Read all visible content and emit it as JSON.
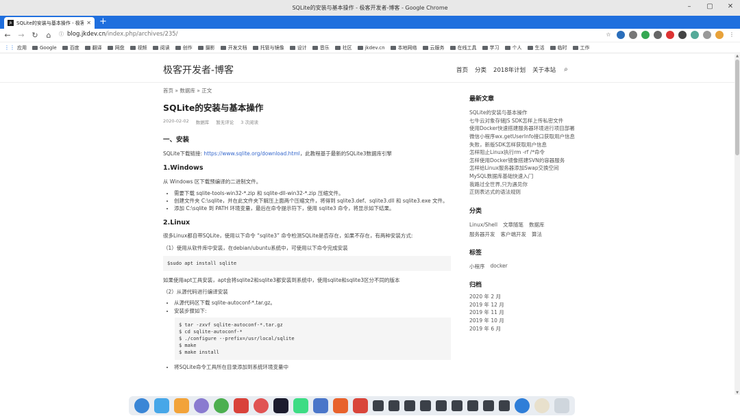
{
  "window": {
    "title": "SQLite的安装与基本操作 - 极客开发者-博客 - Google Chrome"
  },
  "tab": {
    "title": "SQLite的安装与基本操作 - 极客",
    "favicon": "jk"
  },
  "address": {
    "host": "blog.jkdev.cn",
    "path": "/index.php/archives/235/"
  },
  "bookmarks": [
    "应用",
    "Google",
    "百度",
    "翻译",
    "网盘",
    "视频",
    "阅读",
    "创作",
    "摄影",
    "开发文档",
    "托管与镜像",
    "设计",
    "音乐",
    "社区",
    "jkdev.cn",
    "本地网络",
    "云服务",
    "在线工具",
    "学习",
    "个人",
    "生活",
    "临时",
    "工作"
  ],
  "site": {
    "title": "极客开发者-博客",
    "nav": [
      "首页",
      "分类",
      "2018年计划",
      "关于本站"
    ]
  },
  "post": {
    "breadcrumb": "首页 » 数据库 » 正文",
    "title": "SQLite的安装与基本操作",
    "date": "2020-02-02",
    "category": "数据库",
    "comments": "暂无评论",
    "reads": "3 次阅读",
    "h_install": "一、安装",
    "dl_prefix": "SQLite下载链接: ",
    "dl_link": "https://www.sqlite.org/download.html",
    "dl_suffix": "，此教程基于最新的SQLite3数据库引擎",
    "h_windows": "1.Windows",
    "win_intro": "从 Windows 区下载预编译的二进制文件。",
    "win_steps": [
      "需要下载 sqlite-tools-win32-*.zip 和 sqlite-dll-win32-*.zip 压缩文件。",
      "创建文件夹 C:\\sqlite，并在此文件夹下解压上面两个压缩文件，将得到 sqlite3.def、sqlite3.dll 和 sqlite3.exe 文件。",
      "添加 C:\\sqlite 到 PATH 环境变量，最后在命令提示符下，使用 sqlite3 命令，将显示如下结果。"
    ],
    "h_linux": "2.Linux",
    "linux_intro": "很多Linux都自带SQLite，使用以下命令 “sqlite3” 命令检测SQLite是否存在，如果不存在，有两种安装方式:",
    "linux_opt1": "（1）使用从软件库中安装，在debian/ubuntu系统中，可使用以下命令完成安装",
    "code1": "$sudo apt install sqlite",
    "apt_note": "如果使用apt工具安装，apt会将sqlite2和sqlite3都安装到系统中，使用sqlite和sqlite3区分不同的版本",
    "linux_opt2": "（2）从源代码进行编译安装",
    "src_steps": [
      "从源代码区下载 sqlite-autoconf-*.tar.gz。",
      "安装步骤如下:"
    ],
    "code2": [
      "$ tar -zxvf sqlite-autoconf-*.tar.gz",
      "$ cd sqlite-autoconf-*",
      "$ ./configure --prefix=/usr/local/sqlite",
      "$ make",
      "$ make install"
    ],
    "last_step": "将SQLite命令工具所在目录添加到系统环境变量中"
  },
  "sidebar": {
    "recent_title": "最新文章",
    "recent": [
      "SQLite的安装与基本操作",
      "七牛云对象存储JS SDK怎样上传私密文件",
      "使用Docker快速搭建服务器环境进行项目部署",
      "微信小程序wx.getUserInfo接口获取用户信息失败，新版SDK怎样获取用户信息",
      "怎样阻止Linux执行rm -rf /*命令",
      "怎样使用Docker镜像搭建SVN的容器服务",
      "怎样给Linux服务器添加Swap交换空间",
      "MySQL数据库基础快速入门",
      "我路过全世界,只为遇见你",
      "正则表达式的语法规则"
    ],
    "cat_title": "分类",
    "cats": [
      "Linux/Shell",
      "文章随笔",
      "数据库",
      "服务器开发",
      "客户端开发",
      "算法"
    ],
    "tag_title": "标签",
    "tags": [
      "小程序",
      "docker"
    ],
    "arch_title": "归档",
    "archives": [
      "2020 年 2 月",
      "2019 年 12 月",
      "2019 年 11 月",
      "2019 年 10 月",
      "2019 年 6 月"
    ]
  }
}
